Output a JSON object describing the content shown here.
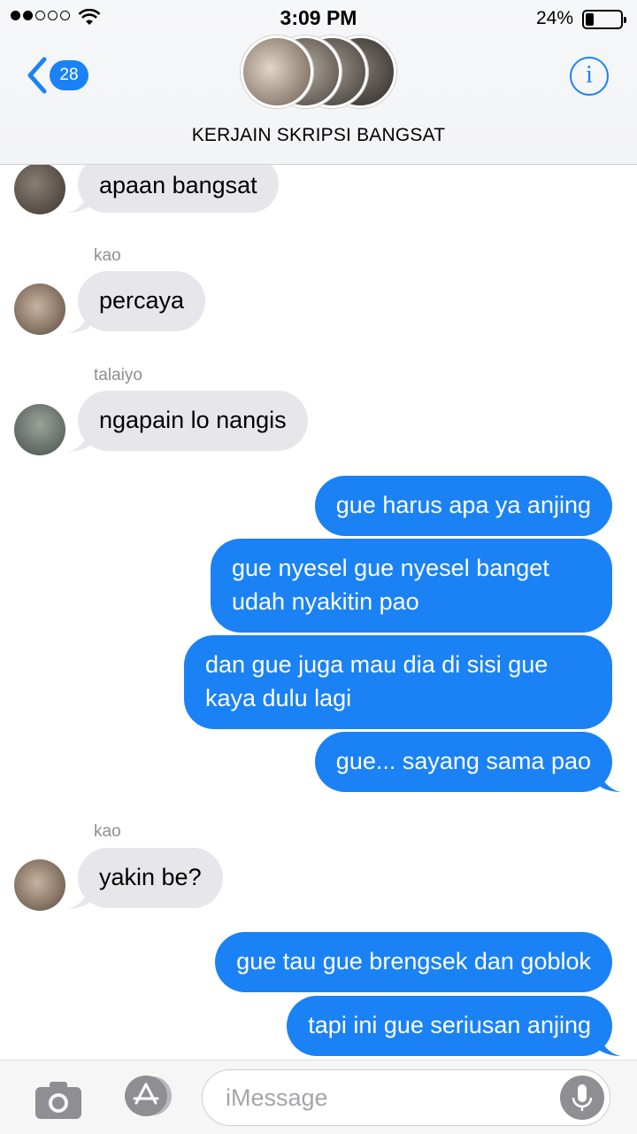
{
  "status_bar": {
    "time": "3:09 PM",
    "battery_percent": "24%",
    "battery_level": 0.24,
    "signal_bars": 2,
    "signal_total": 5
  },
  "header": {
    "back_badge": "28",
    "title": "KERJAIN SKRIPSI BANGSAT",
    "info_icon": "info-icon"
  },
  "messages": [
    {
      "side": "in",
      "sender": "",
      "text": "apaan bangsat"
    },
    {
      "side": "in",
      "sender": "kao",
      "text": "percaya"
    },
    {
      "side": "in",
      "sender": "talaiyo",
      "text": "ngapain lo nangis"
    },
    {
      "side": "out",
      "text": "gue harus apa ya anjing"
    },
    {
      "side": "out",
      "text": "gue nyesel gue nyesel banget udah nyakitin pao"
    },
    {
      "side": "out",
      "text": "dan gue juga mau dia di sisi gue kaya dulu lagi"
    },
    {
      "side": "out",
      "text": "gue... sayang sama pao"
    },
    {
      "side": "in",
      "sender": "kao",
      "text": "yakin be?"
    },
    {
      "side": "out",
      "text": "gue tau gue brengsek dan goblok"
    },
    {
      "side": "out",
      "text": "tapi ini gue seriusan anjing"
    }
  ],
  "composer": {
    "placeholder": "iMessage",
    "value": ""
  },
  "colors": {
    "accent": "#1b82f5",
    "incoming_bubble": "#e6e6eb",
    "outgoing_bubble": "#1b82f5"
  }
}
